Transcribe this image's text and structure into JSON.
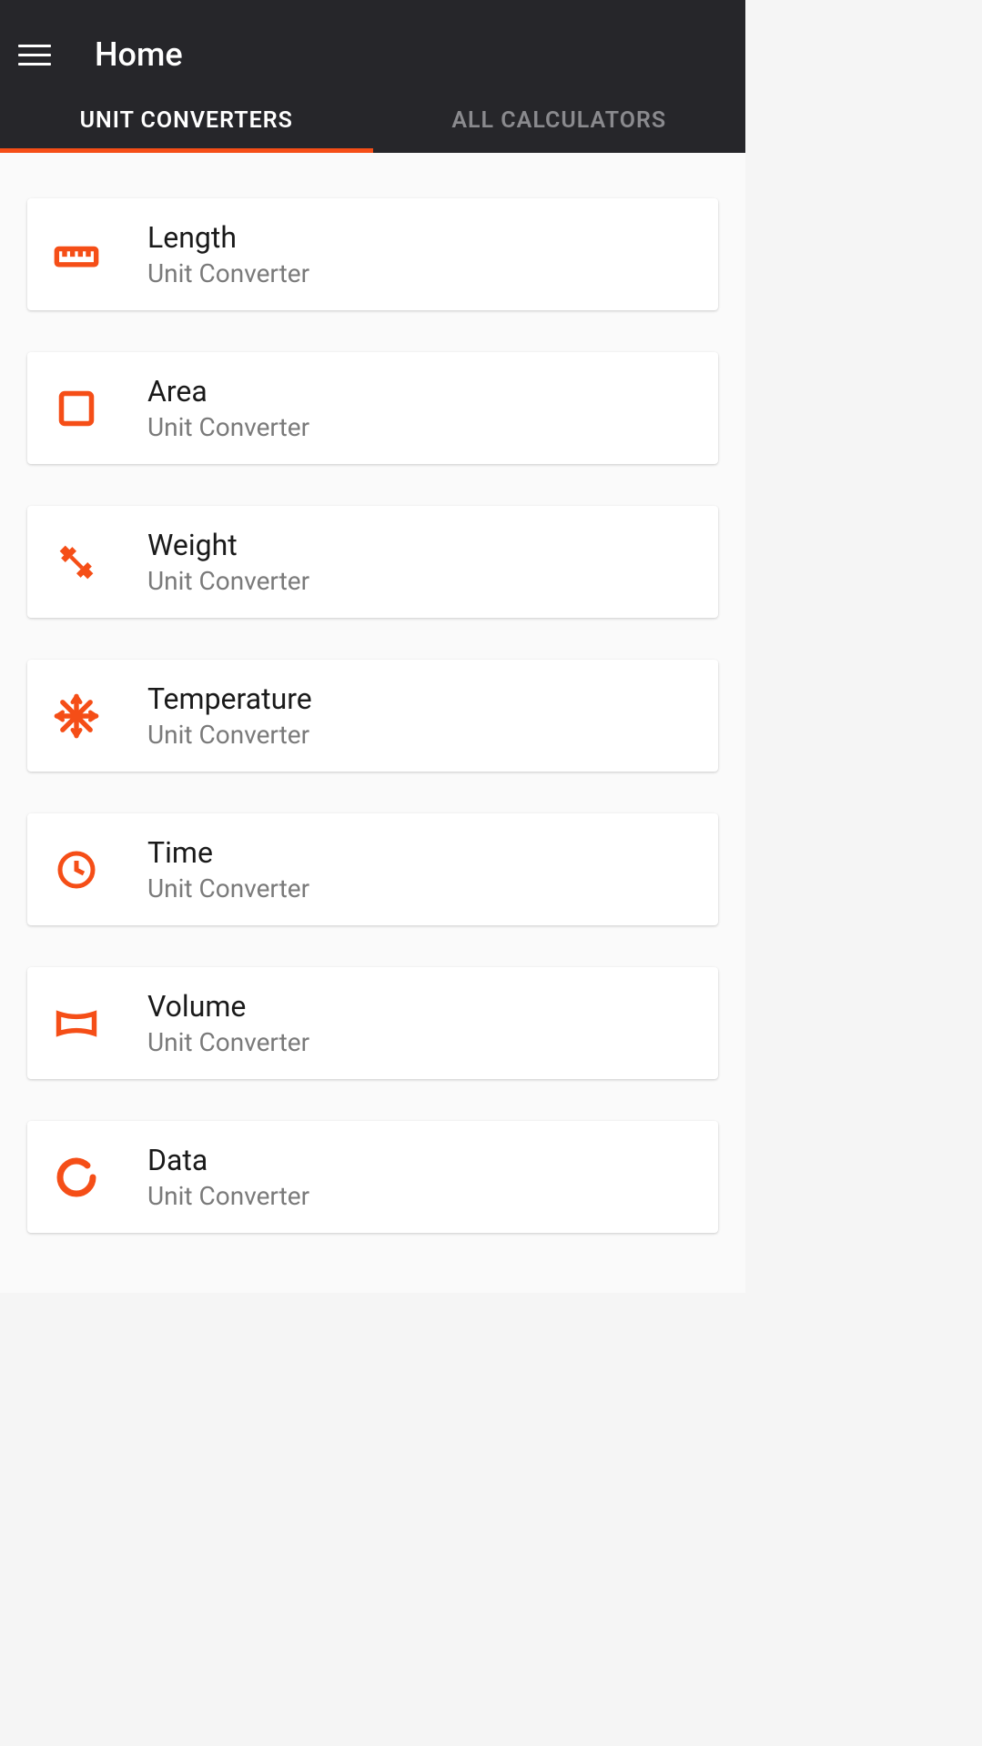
{
  "header": {
    "title": "Home"
  },
  "tabs": {
    "active": "UNIT CONVERTERS",
    "inactive": "ALL CALCULATORS"
  },
  "cards": [
    {
      "title": "Length",
      "subtitle": "Unit Converter",
      "icon": "ruler"
    },
    {
      "title": "Area",
      "subtitle": "Unit Converter",
      "icon": "square"
    },
    {
      "title": "Weight",
      "subtitle": "Unit Converter",
      "icon": "dumbbell"
    },
    {
      "title": "Temperature",
      "subtitle": "Unit Converter",
      "icon": "snowflake"
    },
    {
      "title": "Time",
      "subtitle": "Unit Converter",
      "icon": "clock"
    },
    {
      "title": "Volume",
      "subtitle": "Unit Converter",
      "icon": "panorama"
    },
    {
      "title": "Data",
      "subtitle": "Unit Converter",
      "icon": "data"
    }
  ]
}
